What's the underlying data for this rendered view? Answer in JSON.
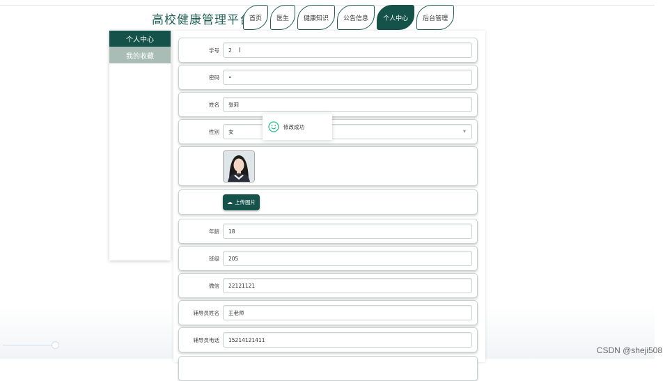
{
  "header": {
    "brand": "高校健康管理平台",
    "tabs": [
      {
        "label": "首页",
        "active": false
      },
      {
        "label": "医生",
        "active": false
      },
      {
        "label": "健康知识",
        "active": false
      },
      {
        "label": "公告信息",
        "active": false
      },
      {
        "label": "个人中心",
        "active": true
      },
      {
        "label": "后台管理",
        "active": false
      }
    ]
  },
  "sidebar": {
    "items": [
      {
        "label": "个人中心",
        "active": true
      },
      {
        "label": "我的收藏",
        "active": false
      }
    ]
  },
  "form": {
    "student_id": {
      "label": "学号",
      "value": "2"
    },
    "password": {
      "label": "密码",
      "value": "•"
    },
    "name": {
      "label": "姓名",
      "value": "张莉"
    },
    "gender": {
      "label": "性别",
      "value": "女"
    },
    "upload_label": "上传图片",
    "age": {
      "label": "年龄",
      "value": "18"
    },
    "class": {
      "label": "班级",
      "value": "205"
    },
    "wechat": {
      "label": "微信",
      "value": "22121121"
    },
    "counselor_name": {
      "label": "辅导员姓名",
      "value": "王老师"
    },
    "counselor_phone": {
      "label": "辅导员电话",
      "value": "15214121411"
    }
  },
  "toast": {
    "message": "修改成功"
  },
  "watermark": "CSDN @sheji508",
  "colors": {
    "brand": "#15524a",
    "sidebar_inactive": "#a9bcb6",
    "toast_icon": "#2bbf8a"
  }
}
